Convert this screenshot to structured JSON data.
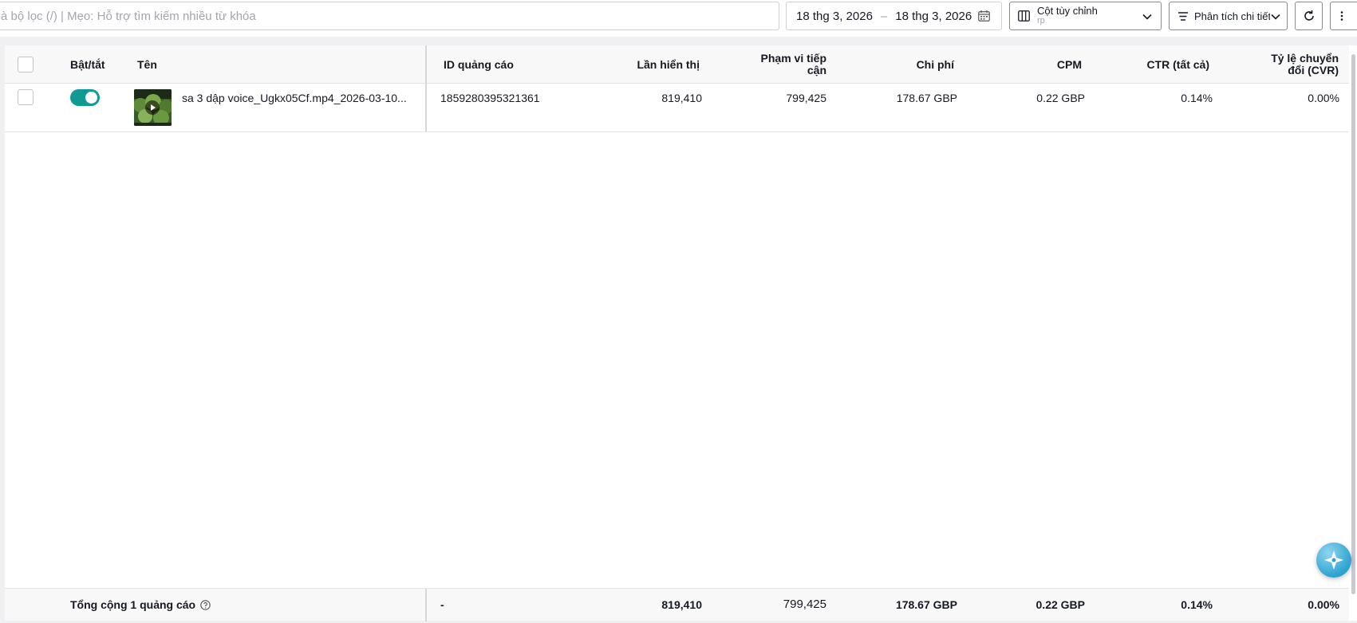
{
  "toolbar": {
    "search_placeholder": "à bộ lọc (/) | Mẹo: Hỗ trợ tìm kiếm nhiều từ khóa",
    "date_start": "18 thg 3, 2026",
    "date_separator": "–",
    "date_end": "18 thg 3, 2026",
    "columns_label": "Cột tùy chỉnh",
    "columns_sub": "rp",
    "analysis_label": "Phân tích chi tiết"
  },
  "table": {
    "headers": {
      "toggle": "Bật/tắt",
      "name": "Tên",
      "ad_id": "ID quảng cáo",
      "impressions": "Lần hiển thị",
      "reach_l1": "Phạm vi tiếp",
      "reach_l2": "cận",
      "cost": "Chi phí",
      "cpm": "CPM",
      "ctr": "CTR (tất cả)",
      "cvr_l1": "Tỷ lệ chuyển",
      "cvr_l2": "đổi (CVR)"
    },
    "rows": [
      {
        "enabled": true,
        "name": "sa 3 dập voice_Ugkx05Cf.mp4_2026-03-10...",
        "ad_id": "1859280395321361",
        "impressions": "819,410",
        "reach": "799,425",
        "cost": "178.67 GBP",
        "cpm": "0.22 GBP",
        "ctr": "0.14%",
        "cvr": "0.00%"
      }
    ],
    "footer": {
      "label": "Tổng cộng 1 quảng cáo",
      "ad_id": "-",
      "impressions": "819,410",
      "reach": "799,425",
      "cost": "178.67 GBP",
      "cpm": "0.22 GBP",
      "ctr": "0.14%",
      "cvr": "0.00%"
    }
  },
  "colors": {
    "toggle_on": "#0f9b94",
    "border": "#d0d1d6",
    "header_bg": "#f8f8f9",
    "panel_bg": "#f0f0f2"
  },
  "icons": [
    "calendar-icon",
    "columns-icon",
    "chevron-down-icon",
    "analysis-icon",
    "refresh-icon",
    "more-icon",
    "play-icon",
    "help-icon",
    "assistant-icon"
  ]
}
